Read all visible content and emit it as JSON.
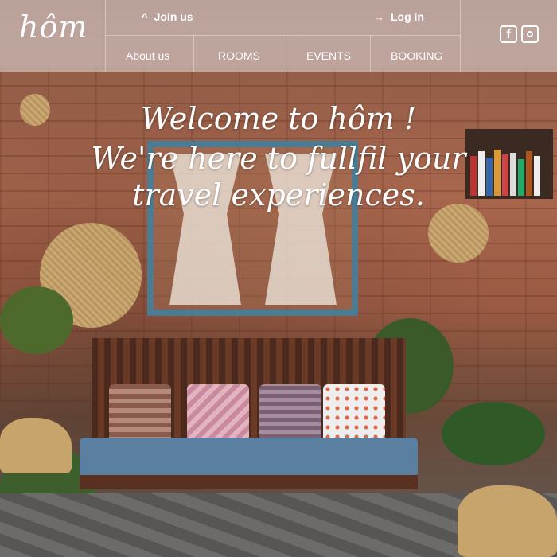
{
  "brand": {
    "logo_text": "hôm"
  },
  "nav": {
    "join_label": "Join us",
    "login_label": "Log in",
    "links": [
      "About us",
      "ROOMS",
      "EVENTS",
      "BOOKING"
    ]
  },
  "social": {
    "facebook_glyph": "f"
  },
  "hero": {
    "line1": "Welcome to hôm !",
    "line2": "We're here to fullfil your travel experiences."
  },
  "colors": {
    "navbar": "#e1dee1",
    "window_frame": "#4a7c93",
    "bench_cushion": "#5a7fa0"
  }
}
